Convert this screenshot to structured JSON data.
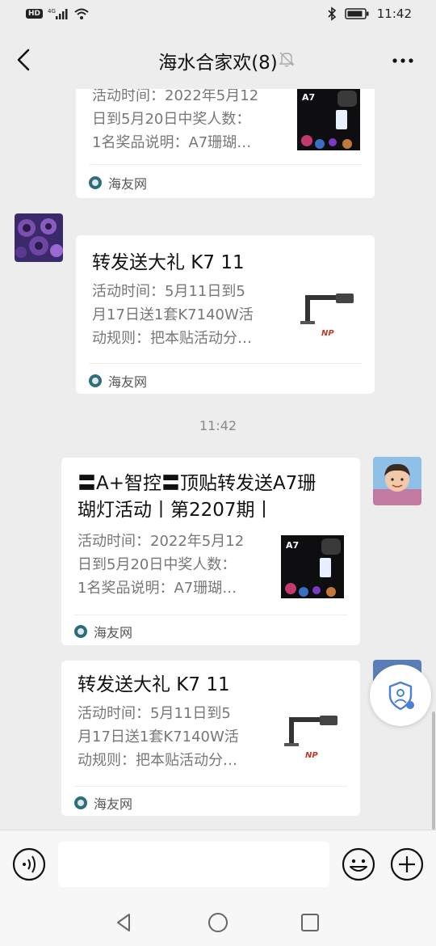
{
  "status_bar": {
    "hd": "HD",
    "network": "4G",
    "time": "11:42"
  },
  "header": {
    "title": "海水合家欢(8)"
  },
  "timestamp": "11:42",
  "messages": [
    {
      "title": "",
      "desc": [
        "活动时间：2022年5月12",
        "日到5月20日中奖人数：",
        "1名奖品说明：A7珊瑚…"
      ],
      "thumb_label": "A7",
      "source": "海友网"
    },
    {
      "title": "转发送大礼 K7 11",
      "desc": [
        "活动时间：5月11日到5",
        "月17日送1套K7140W活",
        "动规则：把本贴活动分…"
      ],
      "source": "海友网"
    },
    {
      "title_lines": [
        "〓A+智控〓顶贴转发送A7珊",
        "瑚灯活动丨第2207期丨"
      ],
      "desc": [
        "活动时间：2022年5月12",
        "日到5月20日中奖人数：",
        "1名奖品说明：A7珊瑚…"
      ],
      "thumb_label": "A7",
      "source": "海友网"
    },
    {
      "title": "转发送大礼 K7 11",
      "desc": [
        "活动时间：5月11日到5",
        "月17日送1套K7140W活",
        "动规则：把本贴活动分…"
      ],
      "source": "海友网"
    }
  ],
  "colors": {
    "background": "#ededed",
    "card": "#ffffff",
    "muted_text": "#777777",
    "accent_blue": "#4a7fd6"
  }
}
